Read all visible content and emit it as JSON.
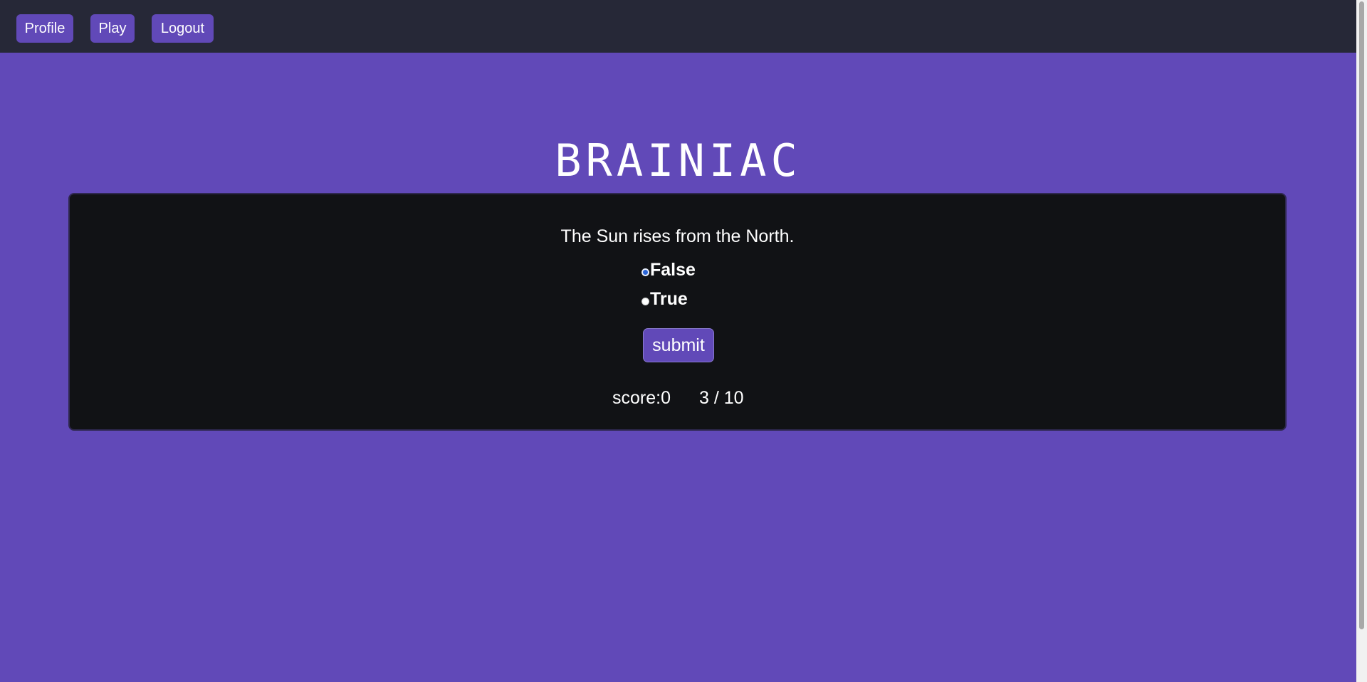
{
  "nav": {
    "profile_label": "Profile",
    "play_label": "Play",
    "logout_label": "Logout"
  },
  "app": {
    "title": "BRAINIAC"
  },
  "quiz": {
    "question": "The Sun rises from the North.",
    "options": [
      {
        "label": "False",
        "selected": true
      },
      {
        "label": "True",
        "selected": false
      }
    ],
    "submit_label": "submit",
    "score_text": "score:0",
    "progress_text": "3 / 10",
    "current_question": 3,
    "total_questions": 10,
    "score": 0
  },
  "colors": {
    "background": "#6149b8",
    "topbar": "#262837",
    "card": "#111215",
    "accent": "#6149b8",
    "radio_selected": "#2a64d6"
  }
}
